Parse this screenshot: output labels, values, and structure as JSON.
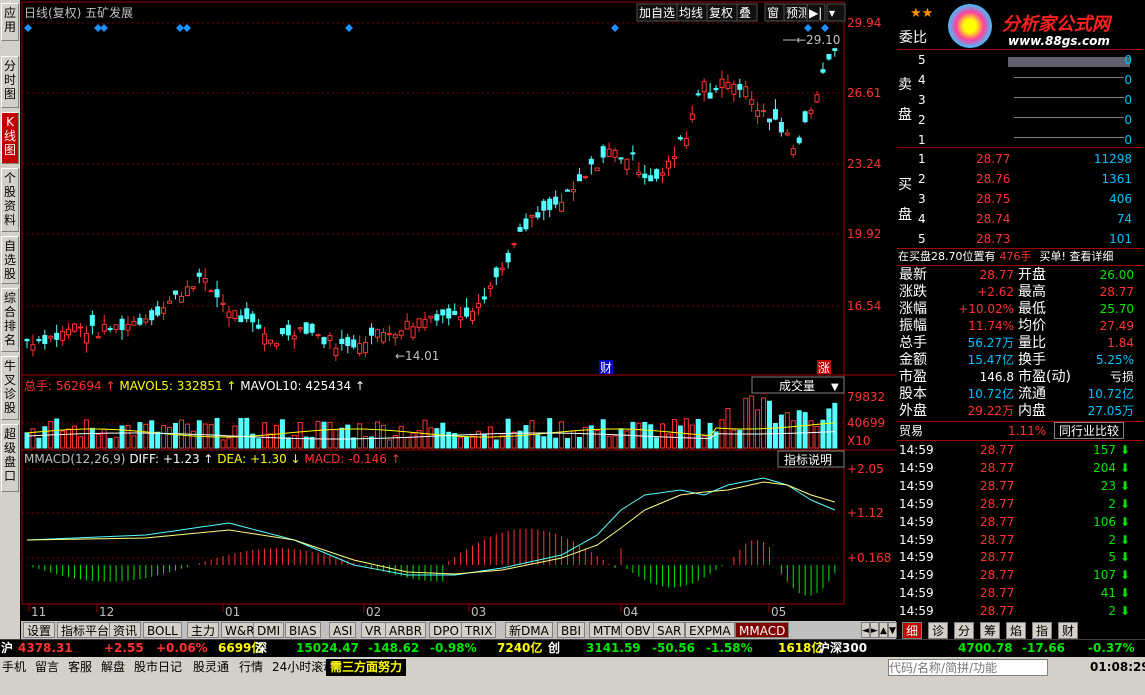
{
  "left_tabs": [
    "应用",
    "分时图",
    "K线图",
    "个股资料",
    "自选股",
    "综合排名",
    "牛叉诊股",
    "超级盘口"
  ],
  "chart": {
    "title": "日线(复权)  五矿发展",
    "toolbar": [
      "加自选",
      "均线",
      "复权",
      "叠",
      "窗",
      "预测",
      "▶|",
      "▾"
    ],
    "price_labels": [
      "29.94",
      "26.61",
      "23.24",
      "19.92",
      "16.54"
    ],
    "high_mark": "29.10",
    "low_mark": "14.01",
    "marker_cai": "财",
    "marker_zhang": "涨",
    "vol_header": {
      "label": "总手:",
      "total": "562694",
      "ma5_label": "MAVOL5:",
      "ma5": "332851",
      "ma10_label": "MAVOL10:",
      "ma10": "425434"
    },
    "vol_select": "成交量",
    "vol_labels": [
      "79832",
      "40699",
      "X10"
    ],
    "macd_header": {
      "label": "MMACD(12,26,9)",
      "diff_label": "DIFF:",
      "diff": "+1.23",
      "dea_label": "DEA:",
      "dea": "+1.30",
      "macd_label": "MACD:",
      "macd": "-0.146"
    },
    "macd_btn": "指标说明",
    "macd_labels": [
      "+2.05",
      "+1.12",
      "+0.168"
    ],
    "x_labels": [
      "11",
      "12",
      "01",
      "02",
      "03",
      "04",
      "05"
    ]
  },
  "bottom_tabs": [
    "设置",
    "指标平台",
    "资讯",
    "BOLL",
    "主力",
    "W&R",
    "DMI",
    "BIAS",
    "ASI",
    "VR",
    "ARBR",
    "DPO",
    "TRIX",
    "新DMA",
    "BBI",
    "MTM",
    "OBV",
    "SAR",
    "EXPMA",
    "MMACD"
  ],
  "right_tabs": [
    "细",
    "诊",
    "分",
    "筹",
    "焰",
    "指",
    "财"
  ],
  "right": {
    "brand": "分析家公式网",
    "brand_url": "www.88gs.com",
    "weibi": "委比",
    "sell_label": "卖盘",
    "buy_label": "买盘",
    "sells": [
      {
        "n": "5",
        "p": "",
        "v": "0"
      },
      {
        "n": "4",
        "p": "",
        "v": "0"
      },
      {
        "n": "3",
        "p": "",
        "v": "0"
      },
      {
        "n": "2",
        "p": "",
        "v": "0"
      },
      {
        "n": "1",
        "p": "",
        "v": "0"
      }
    ],
    "buys": [
      {
        "n": "1",
        "p": "28.77",
        "v": "11298"
      },
      {
        "n": "2",
        "p": "28.76",
        "v": "1361"
      },
      {
        "n": "3",
        "p": "28.75",
        "v": "406"
      },
      {
        "n": "4",
        "p": "28.74",
        "v": "74"
      },
      {
        "n": "5",
        "p": "28.73",
        "v": "101"
      }
    ],
    "notice": "在买盘28.70位置有",
    "notice_vol": "476手",
    "notice_act": "买单! 查看详细",
    "stats": [
      {
        "l1": "最新",
        "v1": "28.77",
        "l2": "开盘",
        "v2": "26.00"
      },
      {
        "l1": "涨跌",
        "v1": "+2.62",
        "l2": "最高",
        "v2": "28.77"
      },
      {
        "l1": "涨幅",
        "v1": "+10.02%",
        "l2": "最低",
        "v2": "25.70"
      },
      {
        "l1": "振幅",
        "v1": "11.74%",
        "l2": "均价",
        "v2": "27.49"
      },
      {
        "l1": "总手",
        "v1": "56.27万",
        "l2": "量比",
        "v2": "1.84"
      },
      {
        "l1": "金额",
        "v1": "15.47亿",
        "l2": "换手",
        "v2": "5.25%"
      },
      {
        "l1": "市盈",
        "v1": "146.8",
        "l2": "市盈(动)",
        "v2": "亏损"
      },
      {
        "l1": "股本",
        "v1": "10.72亿",
        "l2": "流通",
        "v2": "10.72亿"
      },
      {
        "l1": "外盘",
        "v1": "29.22万",
        "l2": "内盘",
        "v2": "27.05万"
      }
    ],
    "sector": "贸易",
    "sector_pct": "1.11%",
    "compare": "同行业比较",
    "ticks": [
      {
        "t": "14:59",
        "p": "28.77",
        "v": "157"
      },
      {
        "t": "14:59",
        "p": "28.77",
        "v": "204"
      },
      {
        "t": "14:59",
        "p": "28.77",
        "v": "23"
      },
      {
        "t": "14:59",
        "p": "28.77",
        "v": "2"
      },
      {
        "t": "14:59",
        "p": "28.77",
        "v": "106"
      },
      {
        "t": "14:59",
        "p": "28.77",
        "v": "2"
      },
      {
        "t": "14:59",
        "p": "28.77",
        "v": "5"
      },
      {
        "t": "14:59",
        "p": "28.77",
        "v": "107"
      },
      {
        "t": "14:59",
        "p": "28.77",
        "v": "41"
      },
      {
        "t": "14:59",
        "p": "28.77",
        "v": "2"
      }
    ]
  },
  "status": {
    "hu": "沪",
    "hu_v": "4378.31",
    "hu_c": "+2.55",
    "hu_p": "+0.06%",
    "hu_amt": "6699亿",
    "shen": "深",
    "shen_v": "15024.47",
    "shen_c": "-148.62",
    "shen_p": "-0.98%",
    "shen_amt": "7240亿",
    "chuang": "创",
    "ch_v": "3141.59",
    "ch_c": "-50.56",
    "ch_p": "-1.58%",
    "ch_amt": "1618亿",
    "hs": "沪深300",
    "hs_v": "4700.78",
    "hs_c": "-17.66",
    "hs_p": "-0.37%"
  },
  "footer": {
    "items": [
      "手机",
      "留言",
      "客服",
      "解盘",
      "股市日记",
      "股灵通",
      "行情",
      "24小时滚动"
    ],
    "news": "需三方面努力",
    "search_placeholder": "代码/名称/简拼/功能",
    "time": "01:08:29"
  }
}
